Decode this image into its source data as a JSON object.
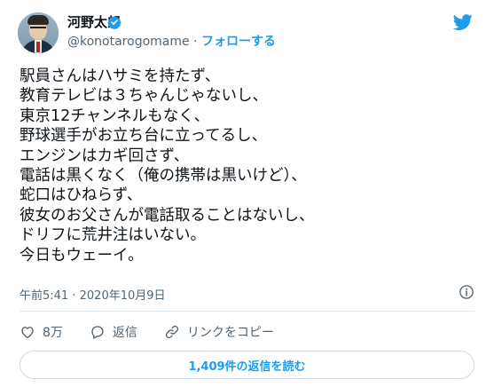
{
  "user": {
    "name": "河野太郎",
    "handle": "@konotarogomame",
    "separator": "·",
    "follow_label": "フォローする"
  },
  "tweet": {
    "lines": [
      "駅員さんはハサミを持たず、",
      "教育テレビは３ちゃんじゃないし、",
      "東京12チャンネルもなく、",
      "野球選手がお立ち台に立ってるし、",
      "エンジンはカギ回さず、",
      "電話は黒くなく（俺の携帯は黒いけど）、",
      "蛇口はひねらず、",
      "彼女のお父さんが電話取ることはないし、",
      "ドリフに荒井注はいない。",
      "今日もウェーイ。"
    ],
    "time": "午前5:41",
    "date_separator": "·",
    "date": "2020年10月9日"
  },
  "actions": {
    "likes_count": "8万",
    "reply_label": "返信",
    "copy_link_label": "リンクをコピー"
  },
  "replies_button_label": "1,409件の返信を読む",
  "colors": {
    "accent": "#1d9bf0",
    "text": "#0f1419",
    "secondary": "#536471",
    "border": "#cfd9de"
  },
  "icons": [
    "verified-badge-icon",
    "twitter-bird-icon",
    "info-icon",
    "heart-icon",
    "reply-icon",
    "link-icon"
  ]
}
